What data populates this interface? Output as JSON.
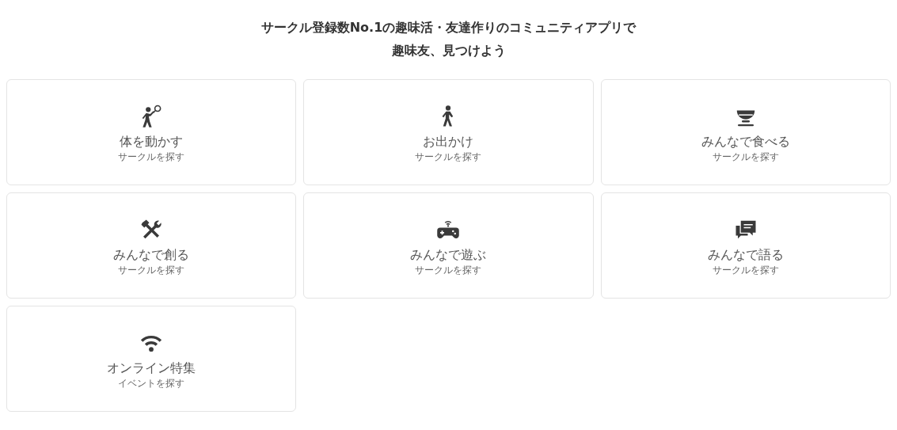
{
  "heading": [
    "サークル登録数No.1の趣味活・友達作りのコミュニティアプリで",
    "趣味友、見つけよう"
  ],
  "categories": [
    {
      "kind": "sports",
      "title": "体を動かす",
      "subtitle": "サークルを探す"
    },
    {
      "kind": "outing",
      "title": "お出かけ",
      "subtitle": "サークルを探す"
    },
    {
      "kind": "food",
      "title": "みんなで食べる",
      "subtitle": "サークルを探す"
    },
    {
      "kind": "craft",
      "title": "みんなで創る",
      "subtitle": "サークルを探す"
    },
    {
      "kind": "game",
      "title": "みんなで遊ぶ",
      "subtitle": "サークルを探す"
    },
    {
      "kind": "talk",
      "title": "みんなで語る",
      "subtitle": "サークルを探す"
    },
    {
      "kind": "online",
      "title": "オンライン特集",
      "subtitle": "イベントを探す"
    }
  ]
}
